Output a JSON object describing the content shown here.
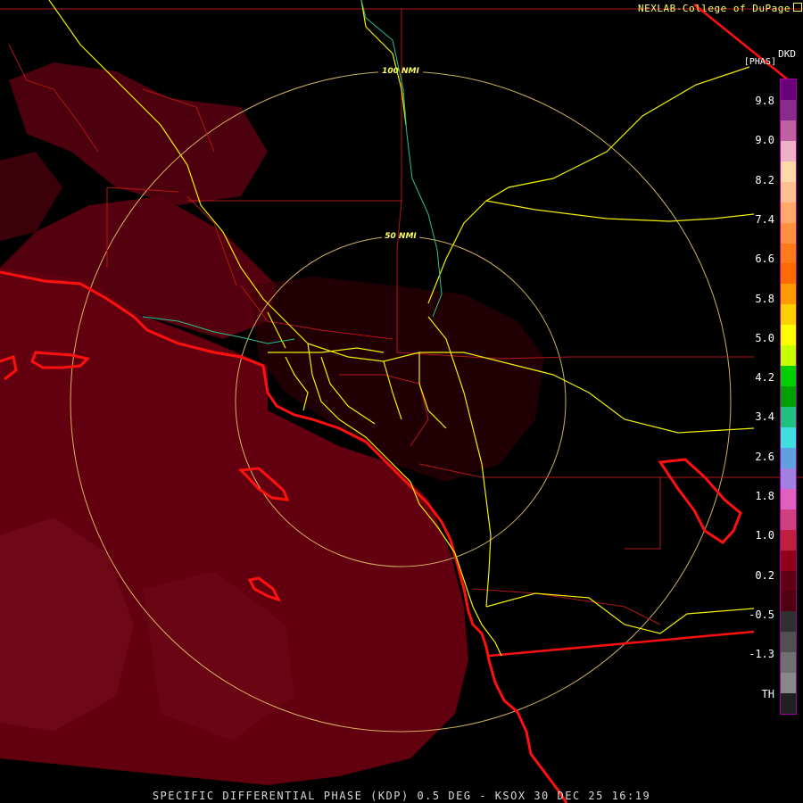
{
  "header": {
    "credit": "NEXLAB-College of DuPage",
    "product_code": "DKD",
    "unit": "[PHAS]"
  },
  "rings": [
    {
      "label": "100 NMI"
    },
    {
      "label": "50 NMI"
    }
  ],
  "colorbar": {
    "labels": [
      "9.8",
      "9.0",
      "8.2",
      "7.4",
      "6.6",
      "5.8",
      "5.0",
      "4.2",
      "3.4",
      "2.6",
      "1.8",
      "1.0",
      "0.2",
      "-0.5",
      "-1.3",
      "TH"
    ],
    "colors": [
      "#6a007a",
      "#8a2a8a",
      "#c060a0",
      "#f0b0c8",
      "#ffd8a8",
      "#ffc090",
      "#ffa868",
      "#ff9040",
      "#ff7a1a",
      "#ff6a00",
      "#ff9a00",
      "#ffd000",
      "#ffff00",
      "#c8ff00",
      "#00d000",
      "#00a000",
      "#20c080",
      "#40e0e0",
      "#60a0e0",
      "#a080e0",
      "#e060c0",
      "#d04080",
      "#c02040",
      "#900018",
      "#600010",
      "#500010",
      "#303030",
      "#505050",
      "#707070",
      "#888888",
      "#202020"
    ]
  },
  "footer": {
    "caption": "SPECIFIC DIFFERENTIAL PHASE (KDP) 0.5 DEG - KSOX 30 DEC 25 16:19"
  }
}
